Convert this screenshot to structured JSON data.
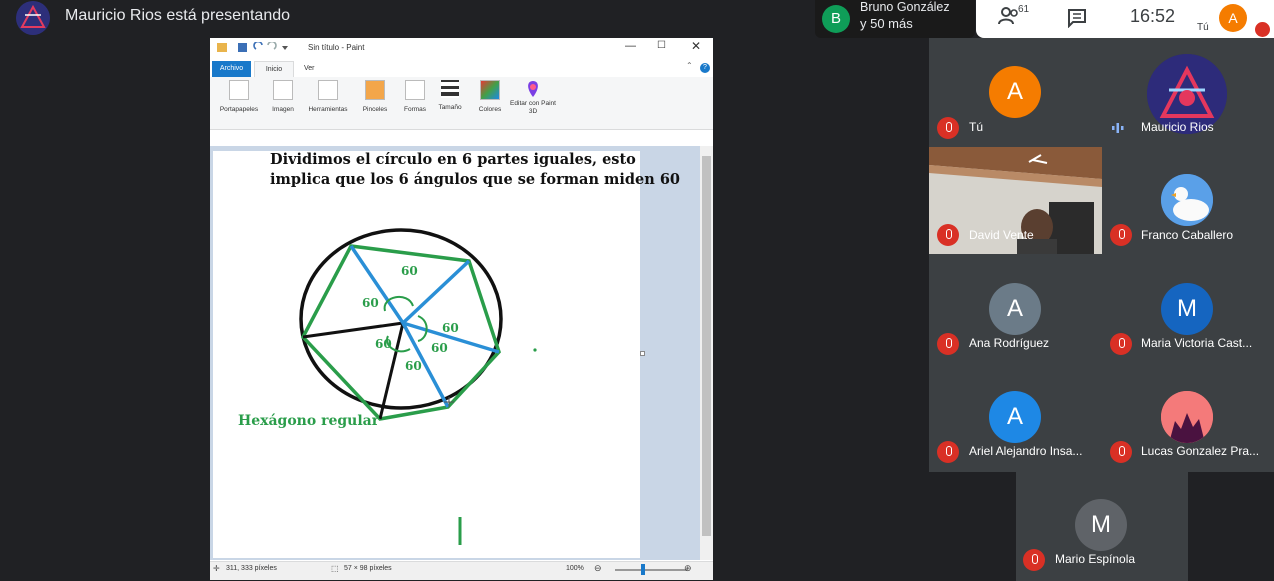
{
  "header": {
    "presenting_text": "Mauricio Rios está presentando",
    "others_initial": "B",
    "others_name": "Bruno González",
    "others_more": "y 50 más",
    "people_count": "61",
    "time": "16:52",
    "self_initial": "A",
    "self_label": "Tú"
  },
  "paint": {
    "title": "Sin título - Paint",
    "tabs": [
      "Archivo",
      "Inicio",
      "Ver"
    ],
    "ribbon": [
      "Portapapeles",
      "Imagen",
      "Herramientas",
      "Pinceles",
      "Formas",
      "Tamaño",
      "Colores",
      "Editar con Paint 3D"
    ],
    "canvas_text_line1": "Dividimos el círculo en 6 partes iguales, esto",
    "canvas_text_line2": "implica que los 6 ángulos que se forman miden 60",
    "angle_labels": [
      "60",
      "60",
      "60",
      "60",
      "60",
      "60"
    ],
    "hexagon_label": "Hexágono regular",
    "status_position": "311, 333 píxeles",
    "status_selection": "57 × 98 píxeles",
    "zoom": "100%",
    "colors": {
      "accent": "#1979ca",
      "green": "#2a9d4a",
      "blue": "#2a8fd6"
    }
  },
  "participants": [
    {
      "name": "Tú",
      "initial": "A",
      "color": "#f57c00"
    },
    {
      "name": "Mauricio Rios",
      "speaking": true
    },
    {
      "name": "David Vente"
    },
    {
      "name": "Franco Caballero"
    },
    {
      "name": "Ana Rodríguez",
      "initial": "A",
      "color": "#6b7b88"
    },
    {
      "name": "Maria Victoria Cast...",
      "initial": "M",
      "color": "#1565c0"
    },
    {
      "name": "Ariel Alejandro Insa...",
      "initial": "A",
      "color": "#1e88e5"
    },
    {
      "name": "Lucas Gonzalez Pra..."
    },
    {
      "name": "Mario Espínola",
      "initial": "M",
      "color": "#5f6368"
    }
  ]
}
